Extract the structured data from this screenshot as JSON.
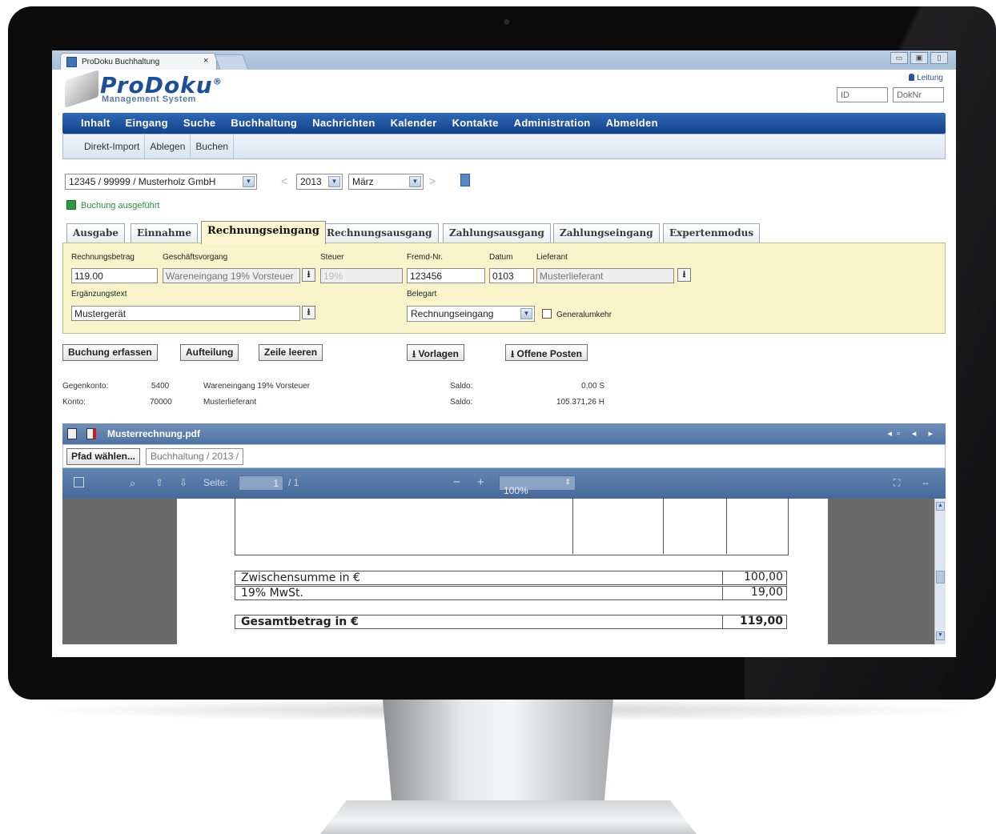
{
  "browser": {
    "tab_title": "ProDoku Buchhaltung",
    "tab_close": "×"
  },
  "window_buttons": [
    "▭",
    "▣",
    "▯"
  ],
  "logo": {
    "name": "ProDoku",
    "mark": "®",
    "tagline": "Management System"
  },
  "header": {
    "user_link": "Leitung",
    "id_placeholder": "ID",
    "doknr_placeholder": "DokNr"
  },
  "main_nav": [
    "Inhalt",
    "Eingang",
    "Suche",
    "Buchhaltung",
    "Nachrichten",
    "Kalender",
    "Kontakte",
    "Administration",
    "Abmelden"
  ],
  "sub_nav": [
    "Direkt-Import",
    "Ablegen",
    "Buchen"
  ],
  "filters": {
    "account": "12345 / 99999 / Musterholz GmbH",
    "prev_arrow": "<",
    "year": "2013",
    "month": "März",
    "next_arrow": ">"
  },
  "status_message": "Buchung ausgeführt",
  "tabs": [
    "Ausgabe",
    "Einnahme",
    "Rechnungseingang",
    "Rechnungsausgang",
    "Zahlungsausgang",
    "Zahlungseingang",
    "Expertenmodus"
  ],
  "active_tab": "Rechnungseingang",
  "form": {
    "rechnungsbetrag": {
      "label": "Rechnungsbetrag",
      "value": "119.00"
    },
    "geschaeftsvorgang": {
      "label": "Geschäftsvorgang",
      "value": "Wareneingang 19% Vorsteuer"
    },
    "steuer": {
      "label": "Steuer",
      "value": "19%"
    },
    "fremd_nr": {
      "label": "Fremd-Nr.",
      "value": "123456"
    },
    "datum": {
      "label": "Datum",
      "value": "0103"
    },
    "lieferant": {
      "label": "Lieferant",
      "value": "Musterlieferant"
    },
    "ergaenzungstext": {
      "label": "Ergänzungstext",
      "value": "Mustergerät"
    },
    "belegart": {
      "label": "Belegart",
      "value": "Rechnungseingang"
    },
    "generalumkehr": {
      "label": "Generalumkehr",
      "checked": false
    },
    "upload_glyph": "⭳"
  },
  "actions": {
    "buchung_erfassen": "Buchung erfassen",
    "aufteilung": "Aufteilung",
    "zeile_leeren": "Zeile leeren",
    "vorlagen": "Vorlagen",
    "offene_posten": "Offene Posten"
  },
  "accounts": {
    "gegenkonto": {
      "label": "Gegenkonto:",
      "number": "5400",
      "name": "Wareneingang 19% Vorsteuer",
      "saldo_label": "Saldo:",
      "saldo": "0,00 S"
    },
    "konto": {
      "label": "Konto:",
      "number": "70000",
      "name": "Musterlieferant",
      "saldo_label": "Saldo:",
      "saldo": "105.371,26 H"
    }
  },
  "viewer": {
    "filename": "Musterrechnung.pdf",
    "controls": "◂▫ ◂ ▸",
    "path_button": "Pfad wählen...",
    "path_value": "Buchhaltung / 2013 /",
    "toolbar": {
      "page_label": "Seite:",
      "page_current": "1",
      "page_total": "/ 1",
      "zoom": "100%",
      "minus": "−",
      "plus": "+"
    },
    "document": {
      "subtotal_label": "Zwischensumme in €",
      "subtotal": "100,00",
      "vat_label": "19% MwSt.",
      "vat": "19,00",
      "total_label": "Gesamtbetrag in €",
      "total": "119,00"
    }
  }
}
